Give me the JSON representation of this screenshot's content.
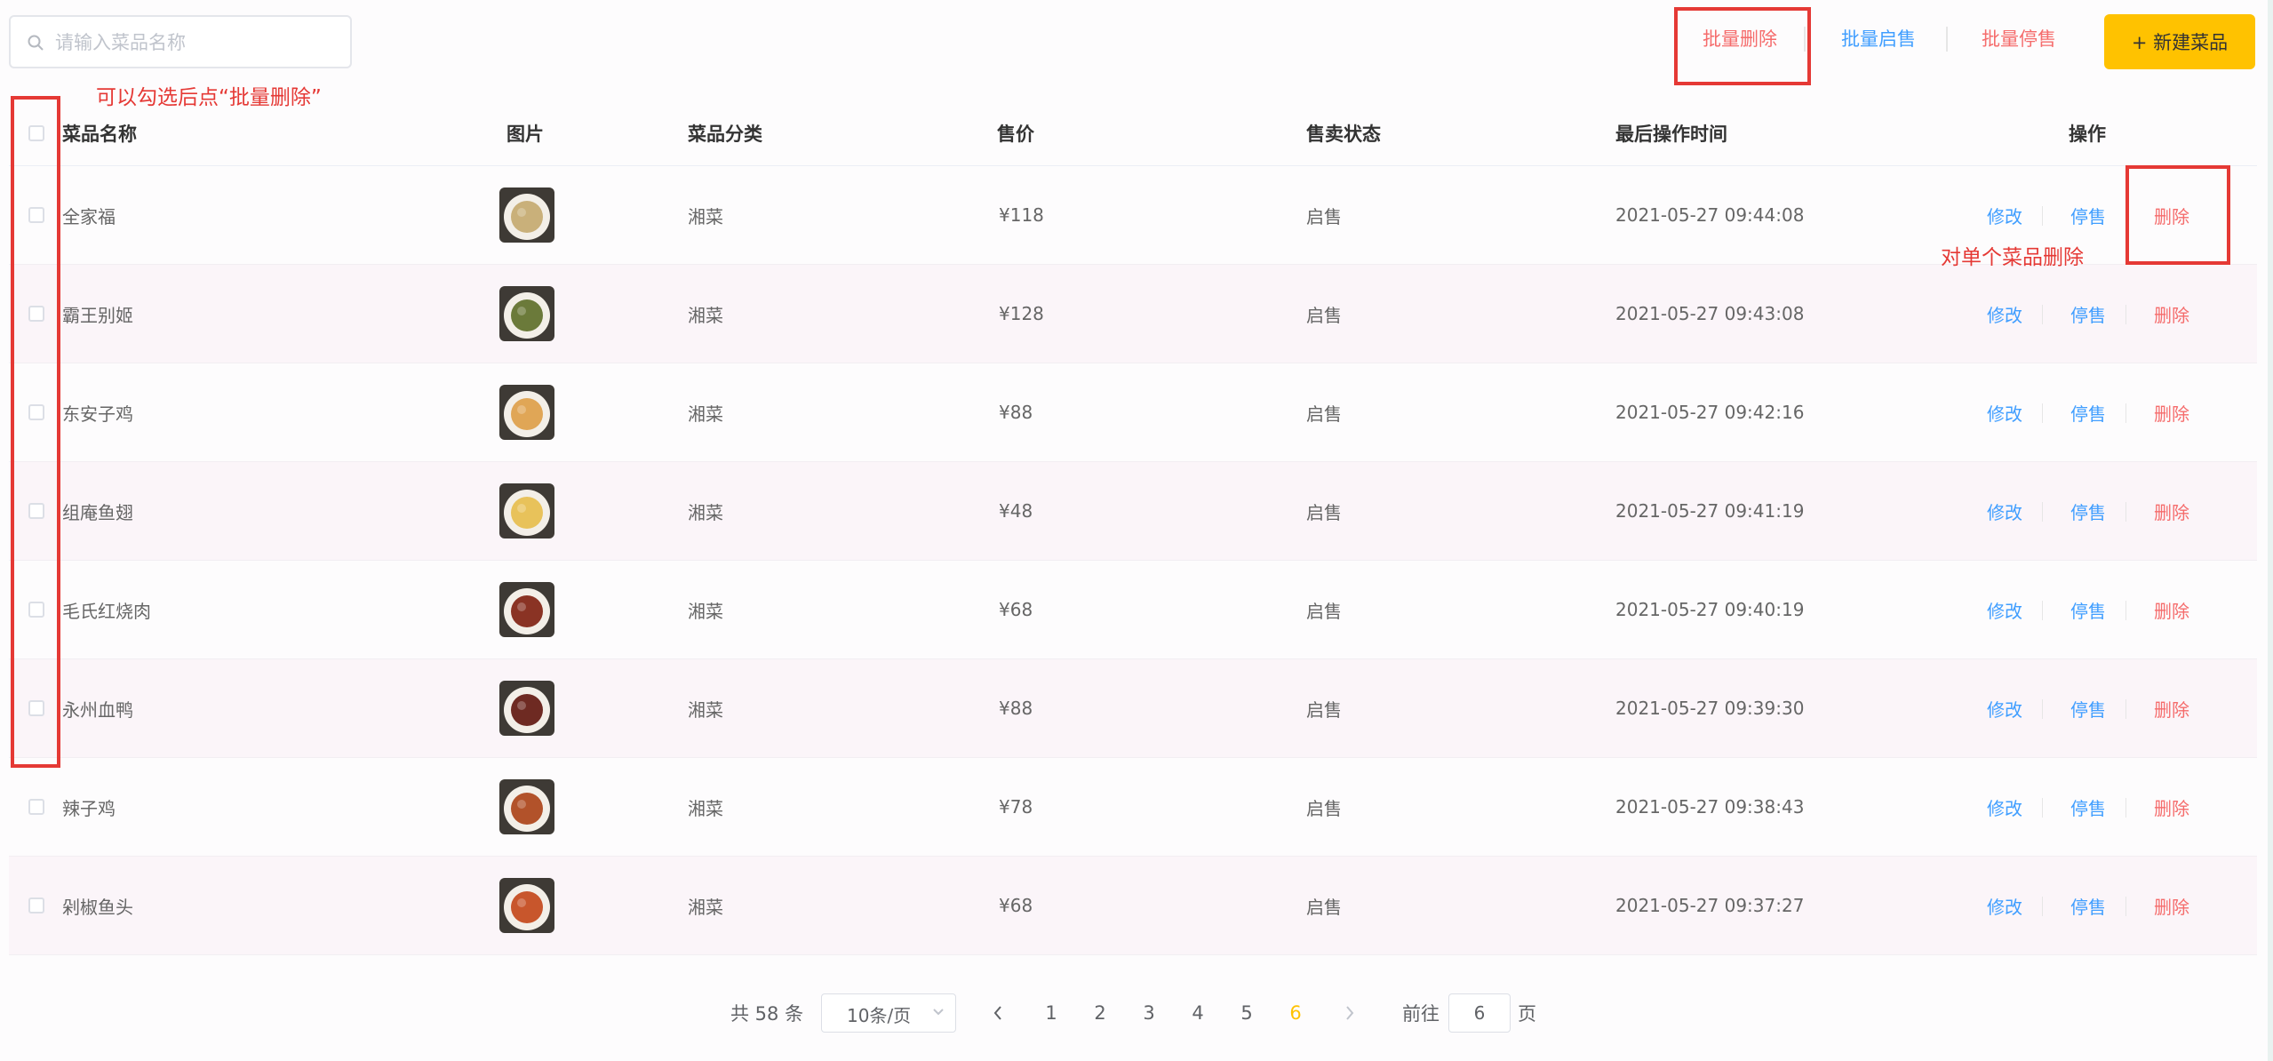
{
  "search": {
    "placeholder": "请输入菜品名称"
  },
  "toolbar": {
    "batch_delete": "批量删除",
    "batch_enable": "批量启售",
    "batch_disable": "批量停售",
    "new_dish": "+ 新建菜品"
  },
  "annotations": {
    "batch_note": "可以勾选后点“批量删除”",
    "single_note": "对单个菜品删除"
  },
  "table": {
    "headers": {
      "name": "菜品名称",
      "image": "图片",
      "category": "菜品分类",
      "price": "售价",
      "status": "售卖状态",
      "updated": "最后操作时间",
      "actions": "操作"
    },
    "rows": [
      {
        "name": "全家福",
        "category": "湘菜",
        "price": "¥118",
        "status": "启售",
        "updated": "2021-05-27 09:44:08",
        "edit": "修改",
        "toggle": "停售",
        "delete": "删除",
        "thumb_color": "#c9b07a"
      },
      {
        "name": "霸王别姬",
        "category": "湘菜",
        "price": "¥128",
        "status": "启售",
        "updated": "2021-05-27 09:43:08",
        "edit": "修改",
        "toggle": "停售",
        "delete": "删除",
        "thumb_color": "#6b7a3a"
      },
      {
        "name": "东安子鸡",
        "category": "湘菜",
        "price": "¥88",
        "status": "启售",
        "updated": "2021-05-27 09:42:16",
        "edit": "修改",
        "toggle": "停售",
        "delete": "删除",
        "thumb_color": "#e0a656"
      },
      {
        "name": "组庵鱼翅",
        "category": "湘菜",
        "price": "¥48",
        "status": "启售",
        "updated": "2021-05-27 09:41:19",
        "edit": "修改",
        "toggle": "停售",
        "delete": "删除",
        "thumb_color": "#e8c25a"
      },
      {
        "name": "毛氏红烧肉",
        "category": "湘菜",
        "price": "¥68",
        "status": "启售",
        "updated": "2021-05-27 09:40:19",
        "edit": "修改",
        "toggle": "停售",
        "delete": "删除",
        "thumb_color": "#8a3324"
      },
      {
        "name": "永州血鸭",
        "category": "湘菜",
        "price": "¥88",
        "status": "启售",
        "updated": "2021-05-27 09:39:30",
        "edit": "修改",
        "toggle": "停售",
        "delete": "删除",
        "thumb_color": "#6e2a22"
      },
      {
        "name": "辣子鸡",
        "category": "湘菜",
        "price": "¥78",
        "status": "启售",
        "updated": "2021-05-27 09:38:43",
        "edit": "修改",
        "toggle": "停售",
        "delete": "删除",
        "thumb_color": "#b2522a"
      },
      {
        "name": "剁椒鱼头",
        "category": "湘菜",
        "price": "¥68",
        "status": "启售",
        "updated": "2021-05-27 09:37:27",
        "edit": "修改",
        "toggle": "停售",
        "delete": "删除",
        "thumb_color": "#c8562c"
      }
    ]
  },
  "pagination": {
    "total": "共 58 条",
    "page_size": "10条/页",
    "pages": [
      "1",
      "2",
      "3",
      "4",
      "5",
      "6"
    ],
    "current_page": "6",
    "goto_label": "前往",
    "goto_value": "6",
    "page_suffix": "页"
  },
  "colors": {
    "accent": "#ffc200",
    "link": "#409eff",
    "danger": "#f56c6c",
    "annotation": "#e53935"
  }
}
